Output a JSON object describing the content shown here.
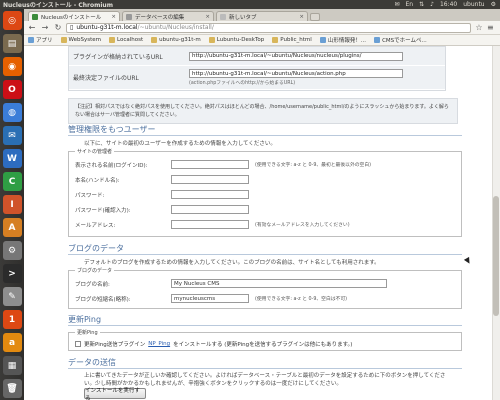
{
  "os_panel": {
    "window_title": "Nucleusのインストール - Chromium",
    "time": "16:40",
    "user": "ubuntu",
    "keyboard": "En",
    "mail_icon": "mail-icon",
    "network_icon": "network-icon",
    "volume_icon": "volume-icon",
    "gear_icon": "gear-icon"
  },
  "launcher": {
    "items": [
      {
        "name": "ubuntu-dash-icon",
        "glyph": "◎",
        "color": "#dd4814"
      },
      {
        "name": "files-icon",
        "glyph": "▤",
        "color": "#7a6a4f"
      },
      {
        "name": "firefox-icon",
        "glyph": "◉",
        "color": "#e66000"
      },
      {
        "name": "opera-icon",
        "glyph": "O",
        "color": "#cc0f16"
      },
      {
        "name": "chromium-icon",
        "glyph": "◍",
        "color": "#3b7dd8"
      },
      {
        "name": "thunderbird-icon",
        "glyph": "✉",
        "color": "#2a6fb4"
      },
      {
        "name": "libreoffice-writer-icon",
        "glyph": "W",
        "color": "#2d6cbf"
      },
      {
        "name": "libreoffice-calc-icon",
        "glyph": "C",
        "color": "#2f9e44"
      },
      {
        "name": "libreoffice-impress-icon",
        "glyph": "I",
        "color": "#d0532a"
      },
      {
        "name": "software-center-icon",
        "glyph": "A",
        "color": "#d67f22"
      },
      {
        "name": "settings-icon",
        "glyph": "⚙",
        "color": "#777777"
      },
      {
        "name": "terminal-icon",
        "glyph": ">",
        "color": "#2b2b2b"
      },
      {
        "name": "text-editor-icon",
        "glyph": "✎",
        "color": "#8e8e8e"
      },
      {
        "name": "ubuntu-one-icon",
        "glyph": "1",
        "color": "#dd4814"
      },
      {
        "name": "amazon-icon",
        "glyph": "a",
        "color": "#e38a10"
      },
      {
        "name": "workspaces-icon",
        "glyph": "▦",
        "color": "#555555"
      },
      {
        "name": "trash-icon",
        "glyph": "🗑",
        "color": "#666666"
      }
    ]
  },
  "browser": {
    "tabs": [
      {
        "label": "Nucleusのインストール",
        "active": true
      },
      {
        "label": "データベースの編集",
        "active": false
      },
      {
        "label": "新しいタブ",
        "active": false
      }
    ],
    "url_host": "ubuntu-g31t-m.local",
    "url_path": "/~ubuntu/Nucleus/install/",
    "bookmarks": [
      {
        "label": "アプリ",
        "type": "apps"
      },
      {
        "label": "WebSystem",
        "type": "folder"
      },
      {
        "label": "Localhost",
        "type": "folder"
      },
      {
        "label": "ubuntu-g31t-m",
        "type": "folder"
      },
      {
        "label": "Lubuntu-DeskTop",
        "type": "folder"
      },
      {
        "label": "Public_html",
        "type": "folder"
      },
      {
        "label": "山形情報発！...",
        "type": "link"
      },
      {
        "label": "CMSでホームペ...",
        "type": "link"
      }
    ]
  },
  "settings_top": {
    "rows": [
      {
        "label": "プラグインが格納されているURL",
        "value": "http://ubuntu-g31t-m.local/~ubuntu/Nucleus/nucleus/plugins/",
        "hint": ""
      },
      {
        "label": "最終決定ファイルのURL",
        "value": "http://ubuntu-g31t-m.local/~ubuntu/Nucleus/action.php",
        "hint": "(action.phpファイルへのhttp://から始まるURL)"
      }
    ]
  },
  "note": "【注記】相対パスではなく絶対パスを使用してください。絶対パスはほとんどの場合、/home/username/public_html/のようにスラッシュから始まります。よく解らない場合はサーバ管理者に質問してください。",
  "admin_section": {
    "title": "管理権限をもつユーザー",
    "description": "以下に、サイトの最初のユーザーを作成するための情報を入力してください。",
    "legend": "サイトの管理者",
    "fields": [
      {
        "label": "表示される名前(ログインID):",
        "value": "",
        "hint": "(使用できる文字: a-z と 0-9、最初と最後以外の空白)"
      },
      {
        "label": "本名(ハンドル名):",
        "value": "",
        "hint": ""
      },
      {
        "label": "パスワード:",
        "value": "",
        "hint": ""
      },
      {
        "label": "パスワード(確認入力):",
        "value": "",
        "hint": ""
      },
      {
        "label": "メールアドレス:",
        "value": "",
        "hint": "(有効なメールアドレスを入力してください)"
      }
    ]
  },
  "blog_section": {
    "title": "ブログのデータ",
    "description": "デフォルトのブログを作成するための情報を入力してください。このブログの名前は、サイト名としても利用されます。",
    "legend": "ブログのデータ",
    "fields": [
      {
        "label": "ブログの名前:",
        "value": "My Nucleus CMS",
        "hint": ""
      },
      {
        "label": "ブログの短縮名(略称):",
        "value": "mynucleuscms",
        "hint": "(使用できる文字: a-z と 0-9、空白は不可)"
      }
    ]
  },
  "ping_section": {
    "title": "更新Ping",
    "legend": "更新Ping",
    "checkbox_prefix": "更新Ping送信プラグイン",
    "checkbox_link": "NP_Ping",
    "checkbox_suffix": "をインストールする (更新Pingを送信するプラグインは他にもあります。)"
  },
  "submit_section": {
    "title": "データの送信",
    "description": "上に書いてきたデータが正しいか確認してください。よければデータベース・テーブルと最初のデータを設定するために下のボタンを押してください。少し時間がかかるかもしれませんが、辛抱強くボタンをクリックするのは一度だけにしてください。",
    "button_label": "インストールを実行する"
  }
}
